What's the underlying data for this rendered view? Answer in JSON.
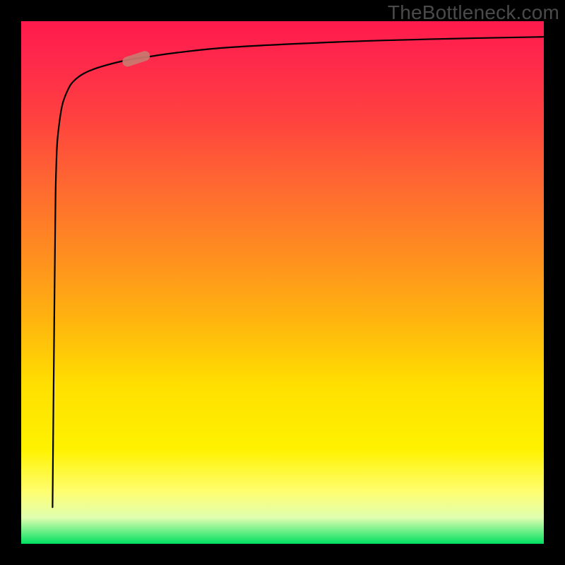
{
  "watermark": "TheBottleneck.com",
  "colors": {
    "background_frame": "#000000",
    "gradient_top": "#ff1a4d",
    "gradient_mid": "#ffe000",
    "gradient_bottom": "#00e060",
    "curve": "#000000",
    "marker": "#c97a6e"
  },
  "chart_data": {
    "type": "line",
    "title": "",
    "xlabel": "",
    "ylabel": "",
    "x_range": [
      0,
      100
    ],
    "y_range": [
      0,
      100
    ],
    "series": [
      {
        "name": "curve",
        "x": [
          6,
          6.2,
          6.5,
          6.6,
          6.7,
          6.8,
          7,
          7.5,
          8,
          9,
          10,
          12,
          15,
          20,
          25,
          30,
          40,
          60,
          80,
          100
        ],
        "y": [
          7,
          30,
          60,
          68,
          72,
          75,
          78,
          82,
          84.5,
          87,
          88.5,
          90,
          91.2,
          92.5,
          93.3,
          94,
          95,
          96,
          96.6,
          97
        ]
      }
    ],
    "marker": {
      "name": "highlight",
      "x": 22,
      "y": 92.8,
      "angle_deg": -18
    },
    "legend": false,
    "grid": false
  }
}
